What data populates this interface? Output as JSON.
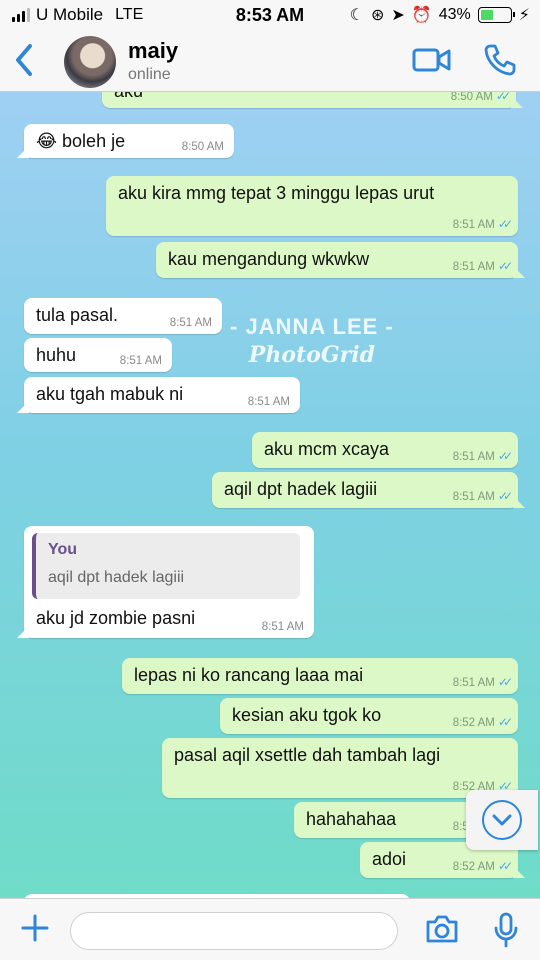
{
  "status_bar": {
    "carrier": "U Mobile",
    "network": "LTE",
    "time": "8:53 AM",
    "battery": "43%",
    "battery_level": 0.43
  },
  "header": {
    "contact_name": "maiy",
    "contact_status": "online"
  },
  "messages": [
    {
      "dir": "out",
      "text": "aku",
      "time": "8:50 AM",
      "ticks": "✓✓"
    },
    {
      "dir": "in",
      "text": "😂 boleh je",
      "time": "8:50 AM"
    },
    {
      "dir": "out",
      "text": "aku kira mmg tepat 3 minggu lepas urut",
      "time": "8:51 AM",
      "ticks": "✓✓"
    },
    {
      "dir": "out",
      "text": "kau mengandung wkwkw",
      "time": "8:51 AM",
      "ticks": "✓✓"
    },
    {
      "dir": "in",
      "text": "tula pasal.",
      "time": "8:51 AM"
    },
    {
      "dir": "in",
      "text": "huhu",
      "time": "8:51 AM"
    },
    {
      "dir": "in",
      "text": "aku tgah mabuk ni",
      "time": "8:51 AM"
    },
    {
      "dir": "out",
      "text": "aku mcm xcaya",
      "time": "8:51 AM",
      "ticks": "✓✓"
    },
    {
      "dir": "out",
      "text": "aqil dpt hadek lagiii",
      "time": "8:51 AM",
      "ticks": "✓✓"
    },
    {
      "dir": "in",
      "text": "aku jd zombie pasni",
      "time": "8:51 AM",
      "quote_author": "You",
      "quote_text": "aqil dpt hadek lagiii"
    },
    {
      "dir": "out",
      "text": "lepas ni ko rancang laaa mai",
      "time": "8:51 AM",
      "ticks": "✓✓"
    },
    {
      "dir": "out",
      "text": "kesian aku tgok ko",
      "time": "8:52 AM",
      "ticks": "✓✓"
    },
    {
      "dir": "out",
      "text": "pasal aqil xsettle dah tambah lagi",
      "time": "8:52 AM",
      "ticks": "✓✓"
    },
    {
      "dir": "out",
      "text": "hahahahaa",
      "time": "8:52 AM",
      "ticks": "✓✓"
    },
    {
      "dir": "out",
      "text": "adoi",
      "time": "8:52 AM",
      "ticks": "✓✓"
    }
  ],
  "watermark": {
    "line1": "- JANNA LEE -",
    "line2": "PhotoGrid"
  },
  "input": {
    "value": "",
    "placeholder": ""
  },
  "colors": {
    "accent": "#2f86d8",
    "outgoing_bubble": "#dcf8c6",
    "incoming_bubble": "#ffffff",
    "read_ticks": "#4fa7e8"
  }
}
